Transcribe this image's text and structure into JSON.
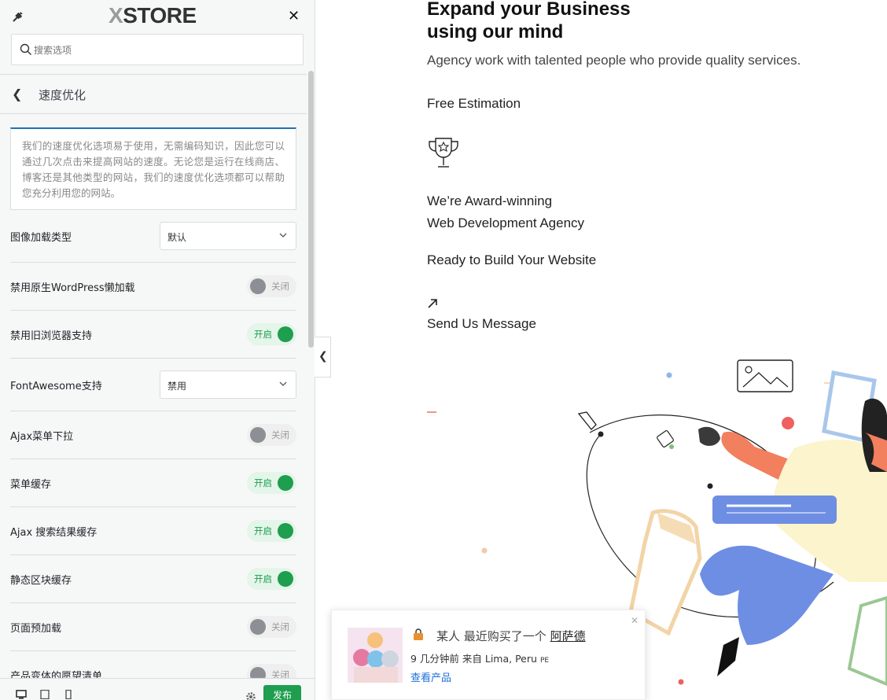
{
  "sidebar": {
    "logo": {
      "prefix": "X",
      "text": "STORE"
    },
    "search_placeholder": "搜索选项",
    "section_title": "速度优化",
    "description": "我们的速度优化选项易于使用，无需编码知识，因此您可以通过几次点击来提高网站的速度。无论您是运行在线商店、博客还是其他类型的网站，我们的速度优化选项都可以帮助您充分利用您的网站。",
    "settings": [
      {
        "label": "图像加载类型",
        "type": "select",
        "value": "默认"
      },
      {
        "label": "禁用原生WordPress懒加载",
        "type": "toggle",
        "state": "off",
        "state_label": "关闭"
      },
      {
        "label": "禁用旧浏览器支持",
        "type": "toggle",
        "state": "on",
        "state_label": "开启"
      },
      {
        "label": "FontAwesome支持",
        "type": "select",
        "value": "禁用"
      },
      {
        "label": "Ajax菜单下拉",
        "type": "toggle",
        "state": "off",
        "state_label": "关闭"
      },
      {
        "label": "菜单缓存",
        "type": "toggle",
        "state": "on",
        "state_label": "开启"
      },
      {
        "label": "Ajax 搜索结果缓存",
        "type": "toggle",
        "state": "on",
        "state_label": "开启"
      },
      {
        "label": "静态区块缓存",
        "type": "toggle",
        "state": "on",
        "state_label": "开启"
      },
      {
        "label": "页面预加载",
        "type": "toggle",
        "state": "off",
        "state_label": "关闭"
      },
      {
        "label": "产品变体的愿望清单",
        "type": "toggle",
        "state": "off",
        "state_label": "关闭"
      }
    ],
    "publish_label": "发布"
  },
  "preview": {
    "heading_line1": "Expand your Business",
    "heading_line2": "using our mind",
    "subheading": "Agency work with talented people who provide quality services.",
    "free_estimation": "Free Estimation",
    "award_line1": "We’re Award-winning",
    "award_line2": "Web Development Agency",
    "ready": "Ready to Build Your Website",
    "send_message": "Send Us Message"
  },
  "popup": {
    "someone": "某人 最近购买了一个",
    "product": "阿萨德",
    "time_from": "9 几分钟前 来自 Lima, Peru",
    "country_code": "PE",
    "view_product": "查看产品"
  },
  "colors": {
    "accent_green": "#1e9e4e",
    "focus_blue": "#2271b1",
    "link_blue": "#1e6fd9"
  }
}
